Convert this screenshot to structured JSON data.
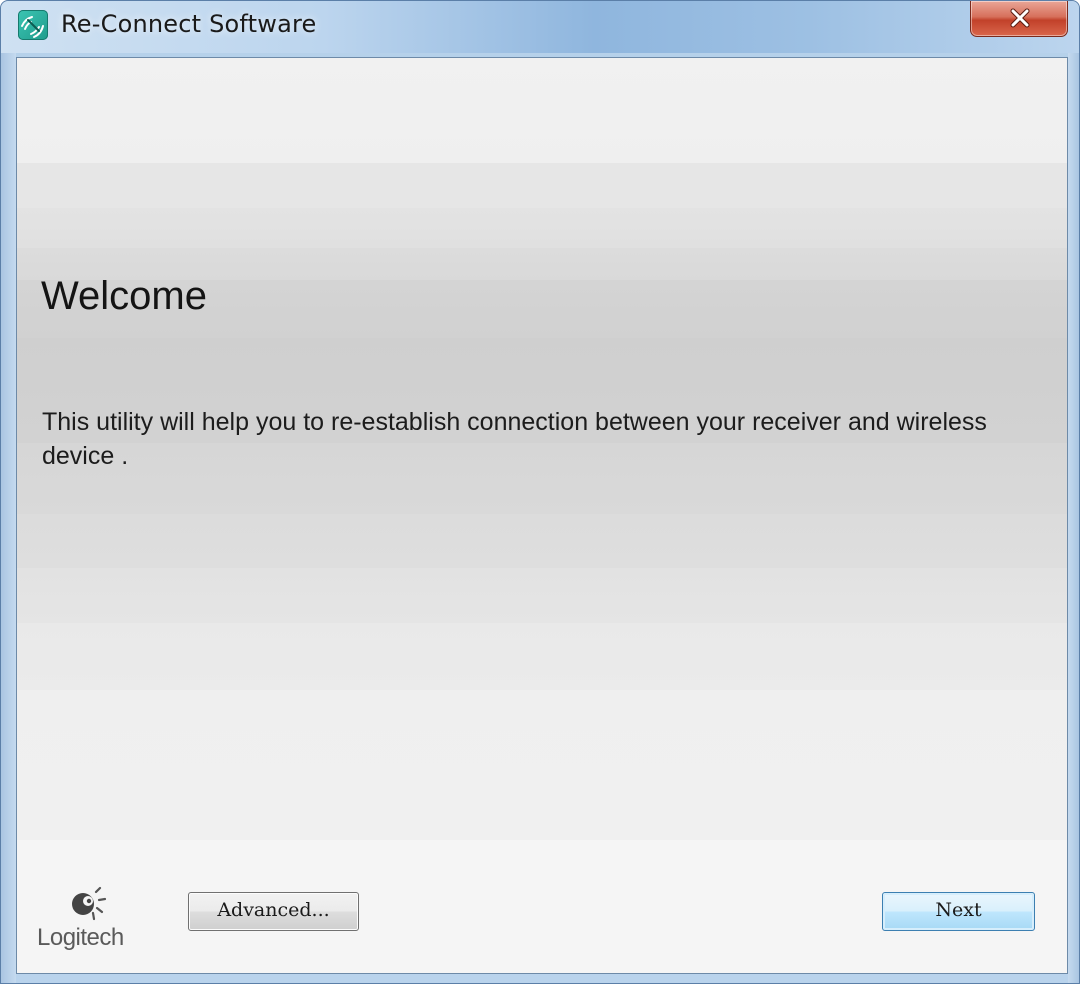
{
  "window": {
    "title": "Re-Connect Software",
    "icon": "reconnect-app-icon",
    "close_icon": "close-icon",
    "accent_color": "#2bb3a3"
  },
  "content": {
    "heading": "Welcome",
    "description": "This utility will help you to re-establish connection between your receiver and wireless device ."
  },
  "footer": {
    "brand": "Logitech",
    "brand_icon": "logitech-logo-icon",
    "advanced_label": "Advanced...",
    "next_label": "Next"
  }
}
